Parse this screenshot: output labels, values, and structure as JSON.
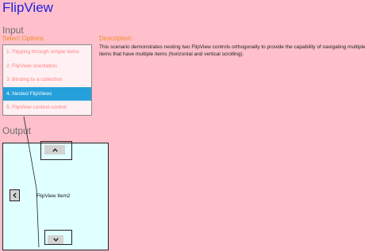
{
  "app_title": "FlipView",
  "input_heading": "Input",
  "select_options_label": "Select Options",
  "scenarios": [
    {
      "label": "1. Flipping through simple items",
      "selected": false
    },
    {
      "label": "2. FlipView orientation",
      "selected": false
    },
    {
      "label": "3. Binding to a collection",
      "selected": false
    },
    {
      "label": "4. Nested FlipViews",
      "selected": true
    },
    {
      "label": "5. FlipView context control",
      "selected": false
    }
  ],
  "description_label": "Description:",
  "description_text": "This scenario demonstrates nesting two FlipView controls orthogonally to provide the capability of navigating multiple items that have multiple items (horizontal and vertical scrolling).",
  "output_heading": "Output",
  "flipview": {
    "item_text": "FlipView Item2",
    "up_icon": "chevron-up-icon",
    "down_icon": "chevron-down-icon",
    "left_icon": "chevron-left-icon"
  },
  "colors": {
    "background": "#ffc0cb",
    "title": "#1f1fe0",
    "accent_orange": "#f08a24",
    "selected_item": "#26a0da",
    "flip_background": "#e0ffff"
  }
}
